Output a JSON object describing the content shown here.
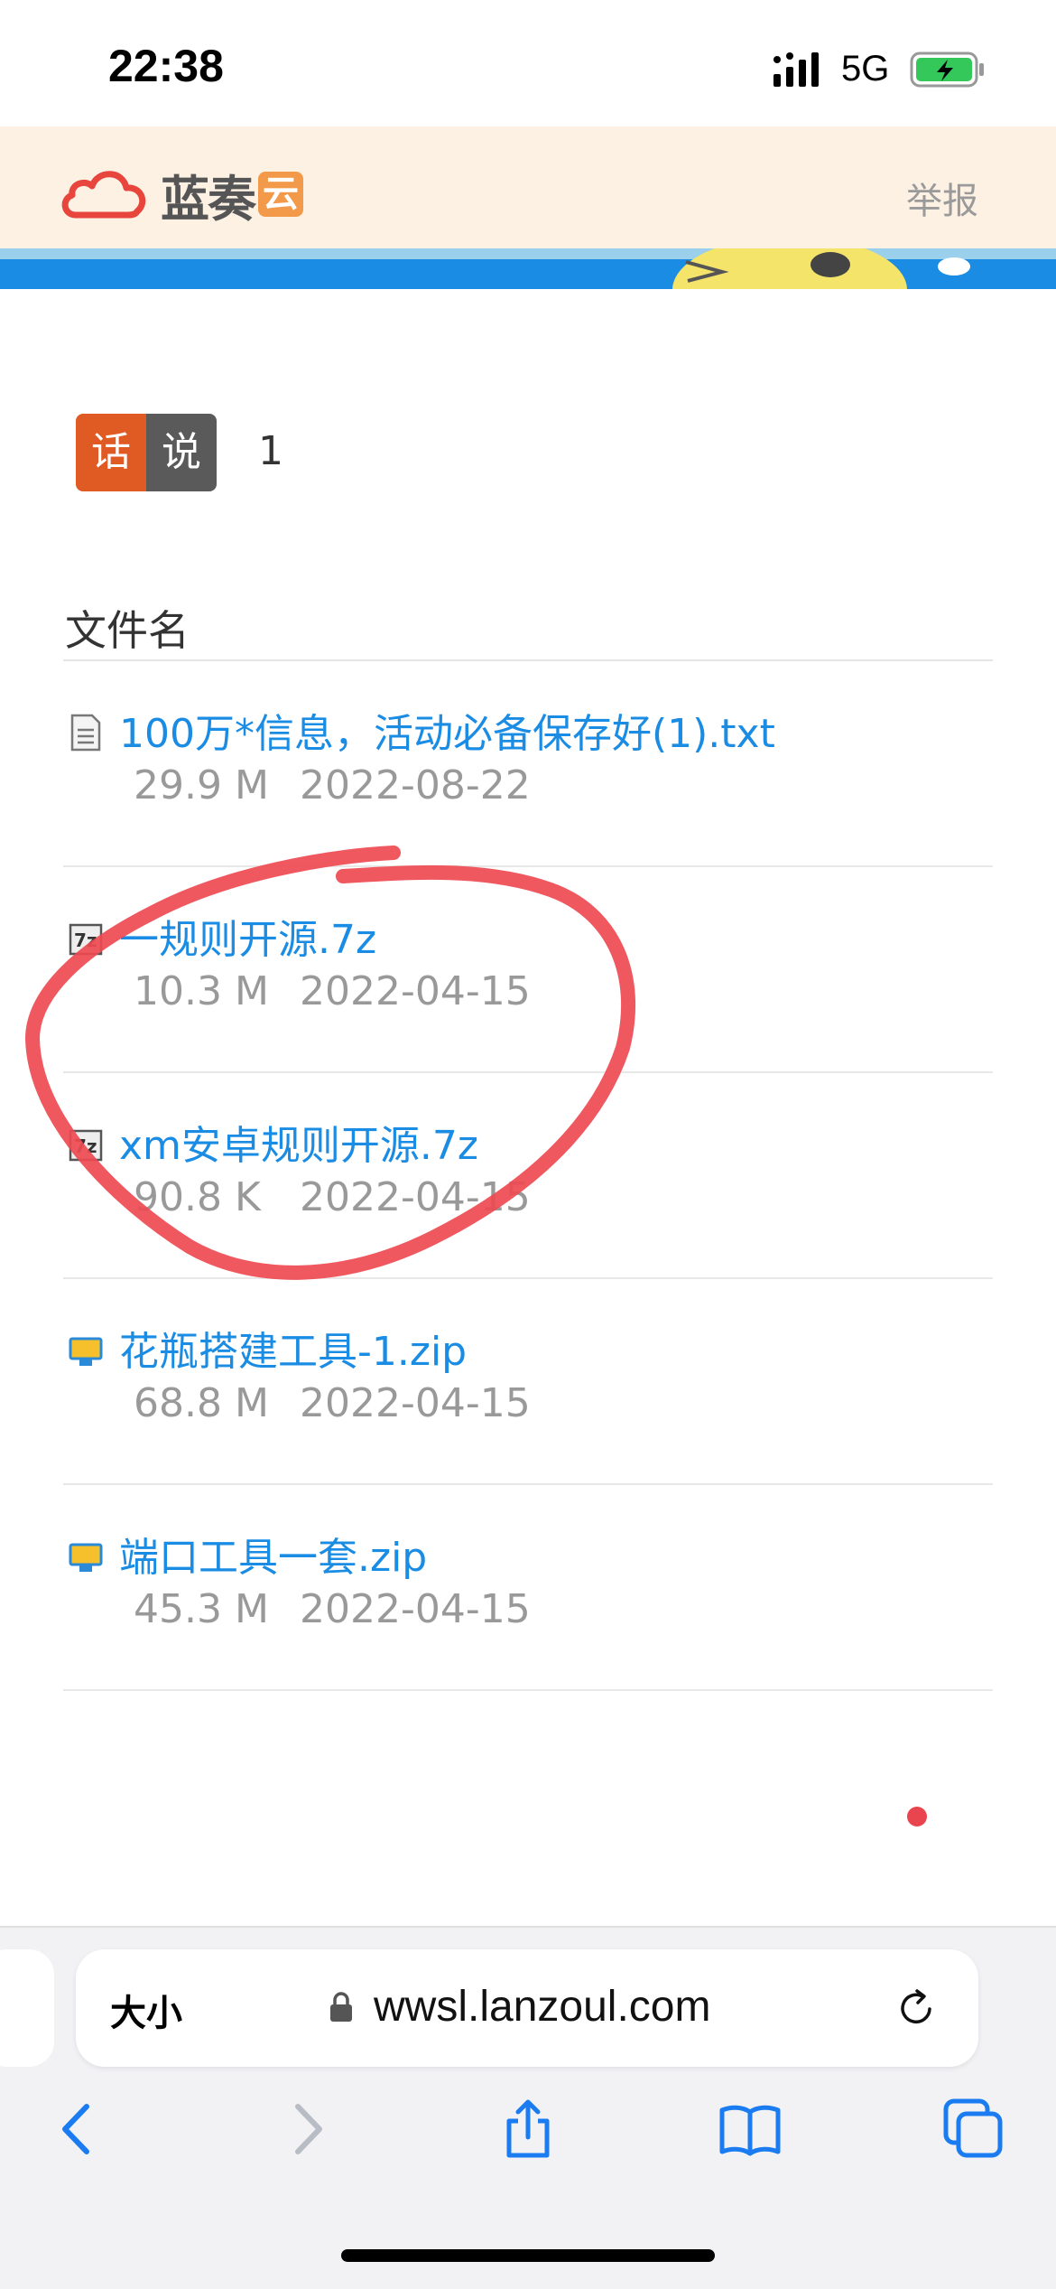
{
  "status_bar": {
    "time": "22:38",
    "network": "5G"
  },
  "site": {
    "logo_text": "蓝奏",
    "logo_badge": "云",
    "report_label": "举报"
  },
  "share": {
    "badge_left": "话",
    "badge_right": "说",
    "count": "1"
  },
  "files": {
    "column_header": "文件名",
    "items": [
      {
        "name": "100万*信息，活动必备保存好(1).txt",
        "size": "29.9 M",
        "date": "2022-08-22",
        "icon": "text-file-icon"
      },
      {
        "name": "一规则开源.7z",
        "size": "10.3 M",
        "date": "2022-04-15",
        "icon": "archive-7z-icon"
      },
      {
        "name": "xm安卓规则开源.7z",
        "size": "90.8 K",
        "date": "2022-04-15",
        "icon": "archive-7z-icon"
      },
      {
        "name": "花瓶搭建工具-1.zip",
        "size": "68.8 M",
        "date": "2022-04-15",
        "icon": "zip-file-icon"
      },
      {
        "name": "端口工具一套.zip",
        "size": "45.3 M",
        "date": "2022-04-15",
        "icon": "zip-file-icon"
      }
    ]
  },
  "browser": {
    "text_size_label": "大小",
    "url": "wwsl.lanzoul.com"
  },
  "colors": {
    "link": "#1a8ce3",
    "annotation": "#e8454f",
    "badge_orange": "#e05a24"
  }
}
